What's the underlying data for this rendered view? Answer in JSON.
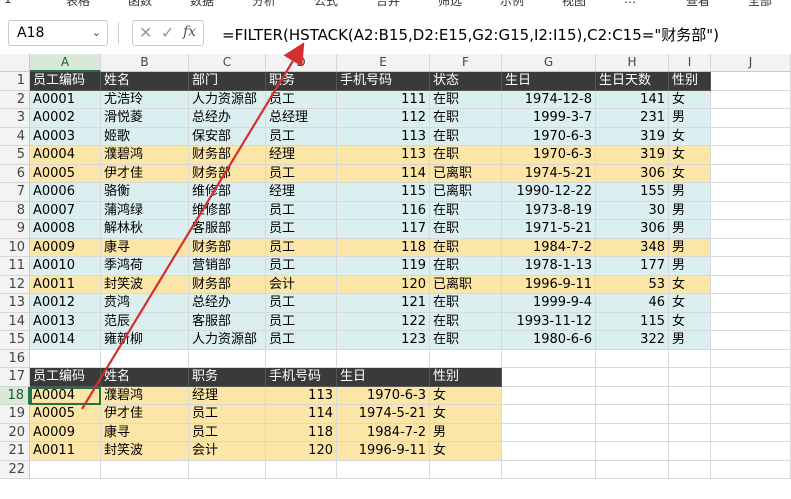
{
  "top_strip": [
    "1",
    "表格",
    "函数",
    "数据",
    "分析",
    "公式",
    "合并",
    "筛选",
    "示例",
    "视图",
    "…",
    "查看",
    "全部"
  ],
  "formula_bar": {
    "name_box": "A18",
    "cancel_icon": "close-icon",
    "enter_icon": "check-icon",
    "fx_label": "fx",
    "formula": "=FILTER(HSTACK(A2:B15,D2:E15,G2:G15,I2:I15),C2:C15=\"财务部\")"
  },
  "columns": [
    "A",
    "B",
    "C",
    "D",
    "E",
    "F",
    "G",
    "H",
    "I",
    "J"
  ],
  "selected_column": "A",
  "rows": [
    "1",
    "2",
    "3",
    "4",
    "5",
    "6",
    "7",
    "8",
    "9",
    "10",
    "11",
    "12",
    "13",
    "14",
    "15",
    "16",
    "17",
    "18",
    "19",
    "20",
    "21",
    "22"
  ],
  "selected_row": "18",
  "source_table": {
    "headers": [
      "员工编码",
      "姓名",
      "部门",
      "职务",
      "手机号码",
      "状态",
      "生日",
      "生日天数",
      "性别"
    ],
    "rows": [
      [
        "A0001",
        "尤浩玲",
        "人力资源部",
        "员工",
        "111",
        "在职",
        "1974-12-8",
        "141",
        "女"
      ],
      [
        "A0002",
        "滑悦菱",
        "总经办",
        "总经理",
        "112",
        "在职",
        "1999-3-7",
        "231",
        "男"
      ],
      [
        "A0003",
        "姬歌",
        "保安部",
        "员工",
        "113",
        "在职",
        "1970-6-3",
        "319",
        "女"
      ],
      [
        "A0004",
        "濮碧鸿",
        "财务部",
        "经理",
        "113",
        "在职",
        "1970-6-3",
        "319",
        "女"
      ],
      [
        "A0005",
        "伊才佳",
        "财务部",
        "员工",
        "114",
        "已离职",
        "1974-5-21",
        "306",
        "女"
      ],
      [
        "A0006",
        "骆衡",
        "维修部",
        "经理",
        "115",
        "已离职",
        "1990-12-22",
        "155",
        "男"
      ],
      [
        "A0007",
        "蒲鸿绿",
        "维修部",
        "员工",
        "116",
        "在职",
        "1973-8-19",
        "30",
        "男"
      ],
      [
        "A0008",
        "解林秋",
        "客服部",
        "员工",
        "117",
        "在职",
        "1971-5-21",
        "306",
        "男"
      ],
      [
        "A0009",
        "康寻",
        "财务部",
        "员工",
        "118",
        "在职",
        "1984-7-2",
        "348",
        "男"
      ],
      [
        "A0010",
        "季鸿荷",
        "营销部",
        "员工",
        "119",
        "在职",
        "1978-1-13",
        "177",
        "男"
      ],
      [
        "A0011",
        "封笑波",
        "财务部",
        "会计",
        "120",
        "已离职",
        "1996-9-11",
        "53",
        "女"
      ],
      [
        "A0012",
        "贲鸿",
        "总经办",
        "员工",
        "121",
        "在职",
        "1999-9-4",
        "46",
        "女"
      ],
      [
        "A0013",
        "范辰",
        "客服部",
        "员工",
        "122",
        "在职",
        "1993-11-12",
        "115",
        "女"
      ],
      [
        "A0014",
        "雍新柳",
        "人力资源部",
        "员工",
        "123",
        "在职",
        "1980-6-6",
        "322",
        "男"
      ]
    ],
    "highlight_rows": [
      3,
      4,
      8,
      10
    ]
  },
  "result_table": {
    "headers": [
      "员工编码",
      "姓名",
      "职务",
      "手机号码",
      "生日",
      "性别"
    ],
    "rows": [
      [
        "A0004",
        "濮碧鸿",
        "经理",
        "113",
        "1970-6-3",
        "女"
      ],
      [
        "A0005",
        "伊才佳",
        "员工",
        "114",
        "1974-5-21",
        "女"
      ],
      [
        "A0009",
        "康寻",
        "员工",
        "118",
        "1984-7-2",
        "男"
      ],
      [
        "A0011",
        "封笑波",
        "会计",
        "120",
        "1996-9-11",
        "女"
      ]
    ]
  },
  "colors": {
    "header_bg": "#3a3a3a",
    "cyan_row": "#dbeff0",
    "yellow_row": "#fbe6a8",
    "arrow": "#d32f2f",
    "selection": "#217346"
  }
}
